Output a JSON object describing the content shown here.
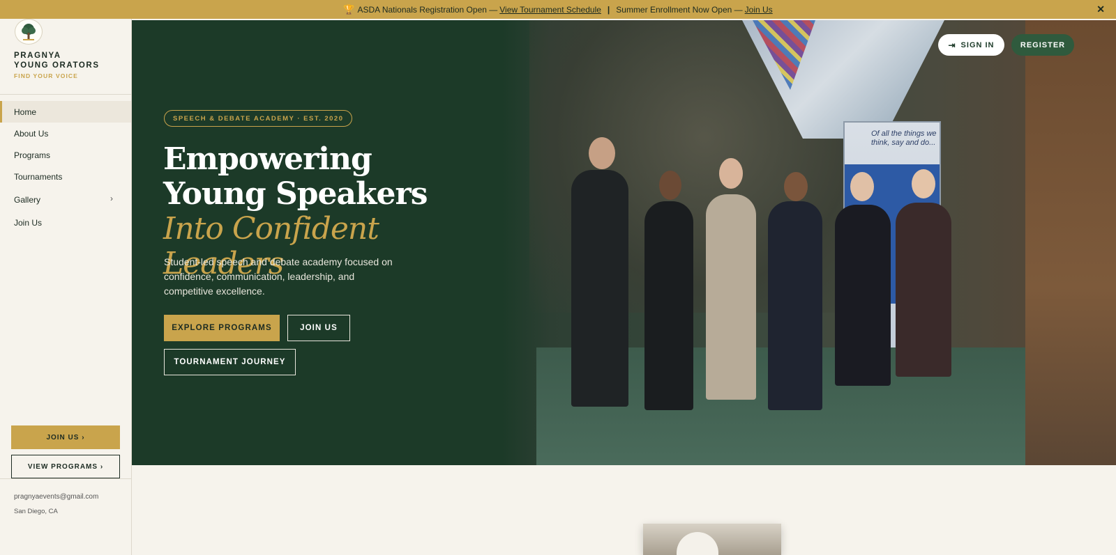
{
  "announcement": {
    "icon": "trophy-icon",
    "text1": "ASDA Nationals Registration Open —",
    "link1": "View Tournament Schedule",
    "separator": "|",
    "text2": "Summer Enrollment Now Open —",
    "link2": "Join Us",
    "close": "✕"
  },
  "sidebar": {
    "brand_line1": "PRAGNYA",
    "brand_line2": "YOUNG ORATORS",
    "tagline": "FIND YOUR VOICE",
    "nav": [
      {
        "label": "Home",
        "active": true
      },
      {
        "label": "About Us"
      },
      {
        "label": "Programs"
      },
      {
        "label": "Tournaments"
      },
      {
        "label": "Gallery",
        "has_submenu": true
      },
      {
        "label": "Join Us"
      }
    ],
    "cta_primary": "JOIN US ›",
    "cta_secondary": "VIEW PROGRAMS ›",
    "email": "pragnyaevents@gmail.com",
    "location": "San Diego, CA"
  },
  "hero": {
    "badge": "SPEECH & DEBATE ACADEMY · EST. 2020",
    "title_part1": "Empowering Young Speakers",
    "title_accent": "Into Confident Leaders",
    "lede": "Student-led speech and debate academy focused on confidence, communication, leadership, and competitive excellence.",
    "btn_explore": "EXPLORE PROGRAMS",
    "btn_join": "JOIN US",
    "btn_journey": "TOURNAMENT JOURNEY",
    "photo_banner_text": "Of all the things we think, say and do..."
  },
  "header_actions": {
    "signin": "SIGN IN",
    "register": "REGISTER"
  },
  "colors": {
    "gold": "#c9a44c",
    "forest": "#1c3a28",
    "cream": "#f6f3ec"
  }
}
